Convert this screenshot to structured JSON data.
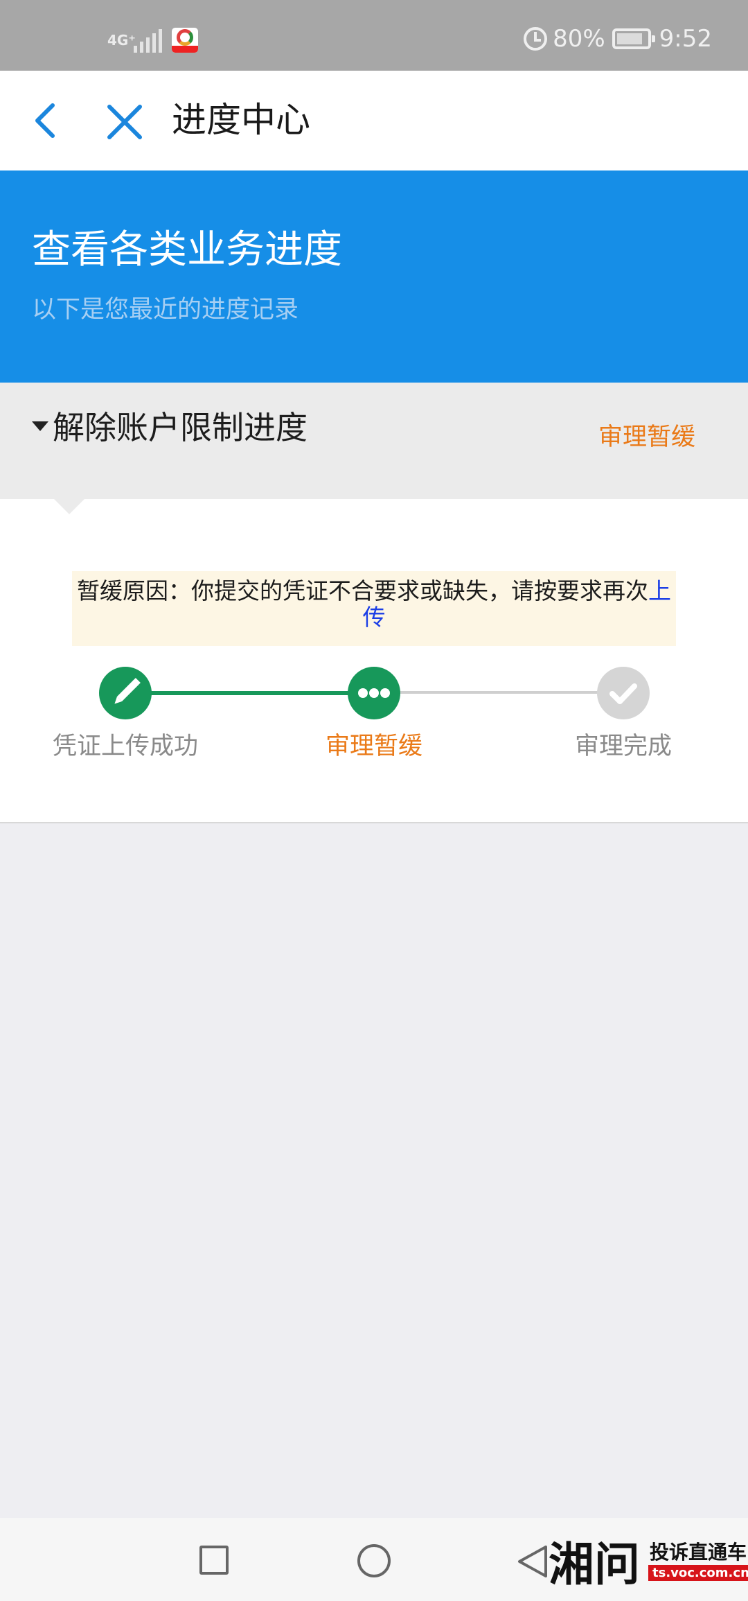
{
  "status_bar": {
    "network": "4G⁺",
    "battery_percent": "80%",
    "time": "9:52"
  },
  "nav": {
    "title": "进度中心"
  },
  "banner": {
    "title": "查看各类业务进度",
    "subtitle": "以下是您最近的进度记录"
  },
  "section": {
    "title": "解除账户限制进度",
    "status": "审理暂缓"
  },
  "notice": {
    "text": "暂缓原因：你提交的凭证不合要求或缺失，请按要求再次",
    "link": "上传"
  },
  "steps": [
    {
      "label": "凭证上传成功",
      "state": "done",
      "icon": "pencil-icon"
    },
    {
      "label": "审理暂缓",
      "state": "current",
      "icon": "more-dots-icon"
    },
    {
      "label": "审理完成",
      "state": "pending",
      "icon": "check-icon"
    }
  ],
  "colors": {
    "brand_blue": "#168ee7",
    "success_green": "#17985a",
    "warning_orange": "#ea7a18",
    "link_blue": "#1b3ee6"
  },
  "watermark": {
    "logo_text": "湘问",
    "name": "投诉直通车",
    "url": "ts.voc.com.cn"
  }
}
